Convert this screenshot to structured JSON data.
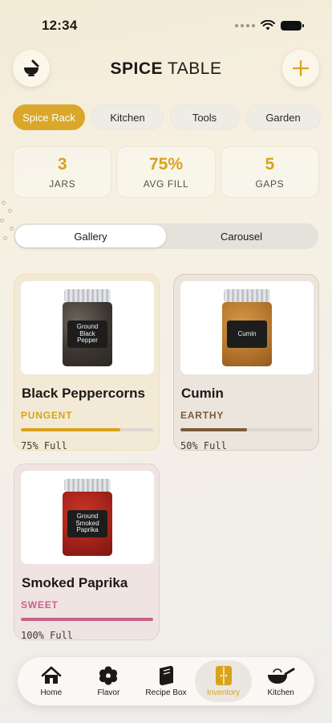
{
  "status_bar": {
    "time": "12:34"
  },
  "header": {
    "title_bold": "SPICE",
    "title_light": "TABLE",
    "left_icon": "mortar-pestle-icon",
    "right_icon": "plus-icon"
  },
  "category_tabs": [
    {
      "label": "Spice Rack",
      "active": true
    },
    {
      "label": "Kitchen",
      "active": false
    },
    {
      "label": "Tools",
      "active": false
    },
    {
      "label": "Garden",
      "active": false
    }
  ],
  "stats": [
    {
      "value": "3",
      "label": "JARS"
    },
    {
      "value": "75%",
      "label": "AVG FILL"
    },
    {
      "value": "5",
      "label": "GAPS"
    }
  ],
  "view_toggle": {
    "options": [
      "Gallery",
      "Carousel"
    ],
    "selected": "Gallery"
  },
  "spices": [
    {
      "name": "Black Peppercorns",
      "tag": "PUNGENT",
      "fill_text": "75% Full",
      "fill": 0.75,
      "jar_label": "Ground Black Pepper",
      "tag_color": "#d9a21a"
    },
    {
      "name": "Cumin",
      "tag": "EARTHY",
      "fill_text": "50% Full",
      "fill": 0.5,
      "jar_label": "Cumin",
      "tag_color": "#7a5a3a"
    },
    {
      "name": "Smoked Paprika",
      "tag": "SWEET",
      "fill_text": "100% Full",
      "fill": 1.0,
      "jar_label": "Ground Smoked Paprika",
      "tag_color": "#c8628a"
    }
  ],
  "bottom_nav": [
    {
      "label": "Home",
      "icon": "house-icon",
      "active": false
    },
    {
      "label": "Flavor",
      "icon": "flower-icon",
      "active": false
    },
    {
      "label": "Recipe Box",
      "icon": "recipe-book-icon",
      "active": false
    },
    {
      "label": "Inventory",
      "icon": "cabinet-icon",
      "active": true
    },
    {
      "label": "Kitchen",
      "icon": "wok-icon",
      "active": false
    }
  ],
  "colors": {
    "accent": "#d9a21a",
    "earthy": "#7a5a3a",
    "sweet": "#c8628a"
  }
}
